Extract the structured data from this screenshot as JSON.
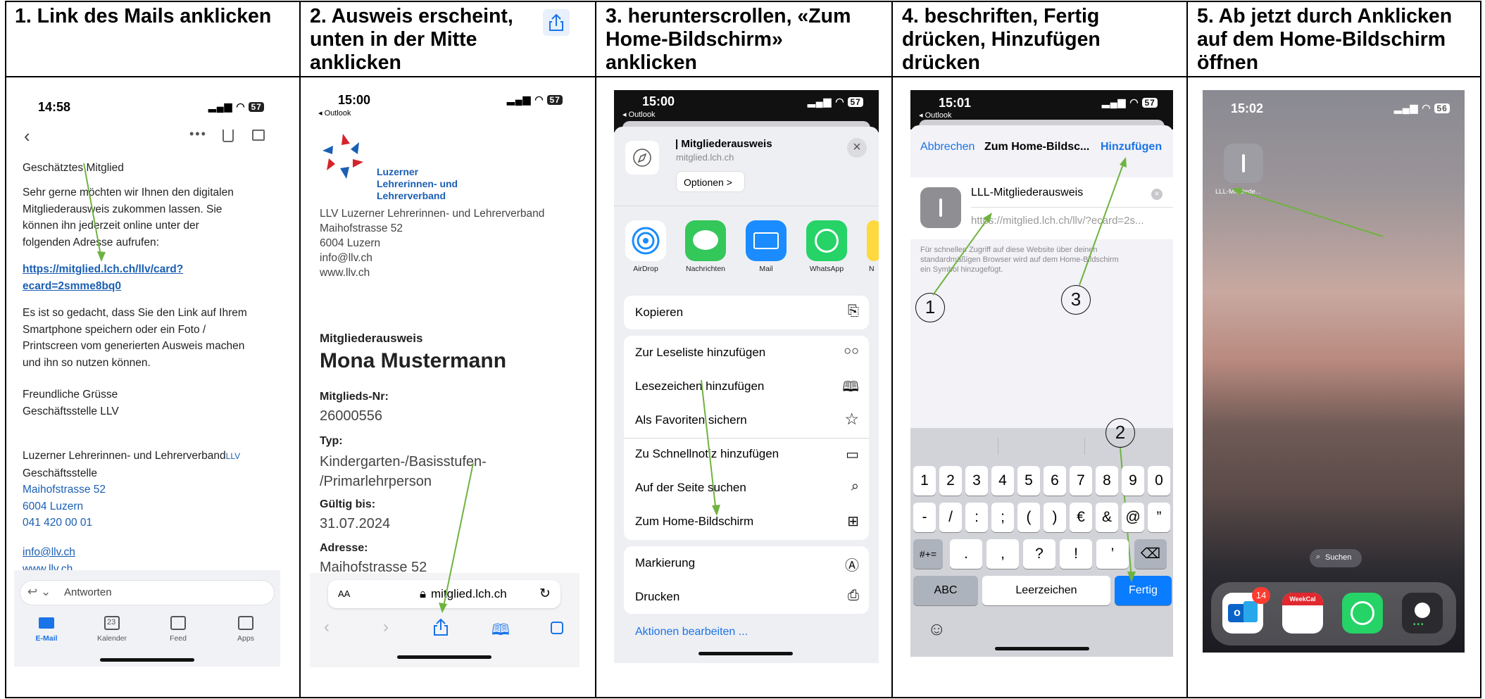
{
  "headers": [
    [
      "1. Link des Mails anklicken"
    ],
    [
      "2. Ausweis erscheint,",
      "unten in der Mitte",
      "anklicken"
    ],
    [
      "3. herunterscrollen, «Zum",
      "Home-Bildschirm»",
      "anklicken"
    ],
    [
      "4. beschriften, Fertig",
      "drücken, Hinzufügen",
      "drücken"
    ],
    [
      "5. Ab jetzt durch Anklicken",
      "auf dem Home-Bildschirm",
      "öffnen"
    ]
  ],
  "colors": {
    "accent_blue": "#0a7cff",
    "arrow_green": "#6fb33f",
    "link_blue": "#1a5fb4"
  },
  "phone1": {
    "time": "14:58",
    "battery": "57",
    "salutation": "Geschätztes Mitglied",
    "para1": [
      "Sehr gerne möchten wir Ihnen den digitalen",
      "Mitgliederausweis zukommen lassen. Sie",
      "können ihn jederzeit online unter der",
      "folgenden Adresse aufrufen:"
    ],
    "link": [
      "https://mitglied.lch.ch/llv/card?",
      "ecard=2smme8bq0"
    ],
    "para2": [
      "Es ist so gedacht, dass Sie den Link auf Ihrem",
      "Smartphone speichern oder ein Foto /",
      "Printscreen vom generierten Ausweis machen",
      "und ihn so nutzen können."
    ],
    "greeting": [
      "Freundliche Grüsse",
      "Geschäftsstelle LLV"
    ],
    "org_name": "Luzerner Lehrerinnen- und Lehrerverband",
    "org_abbr": "LLV",
    "org_office": "Geschäftsstelle",
    "street": "Maihofstrasse 52",
    "city": "6004 Luzern",
    "phone": "041 420 00 01",
    "email": "info@llv.ch",
    "web": "www.llv.ch",
    "reply": "Antworten",
    "tabs": [
      "E-Mail",
      "Kalender",
      "Feed",
      "Apps"
    ],
    "calendar_day": "23"
  },
  "phone2": {
    "time": "15:00",
    "back": "◂ Outlook",
    "battery": "57",
    "logo_text": [
      "Luzerner",
      "Lehrerinnen- und",
      "Lehrerverband"
    ],
    "address": [
      "LLV Luzerner Lehrerinnen- und Lehrerverband",
      "Maihofstrasse 52",
      "6004 Luzern",
      "info@llv.ch",
      "www.llv.ch"
    ],
    "card_label": "Mitgliederausweis",
    "member_name": "Mona Mustermann",
    "nr_label": "Mitglieds-Nr:",
    "nr_value": "26000556",
    "type_label": "Typ:",
    "type_value": [
      "Kindergarten-/Basisstufen-",
      "/Primarlehrperson"
    ],
    "valid_label": "Gültig bis:",
    "valid_value": "31.07.2024",
    "addr_label": "Adresse:",
    "addr_value": "Maihofstrasse 52",
    "aa": "AA",
    "url": "mitglied.lch.ch"
  },
  "phone3": {
    "time": "15:00",
    "back": "◂ Outlook",
    "battery": "57",
    "page_title": "| Mitgliederausweis",
    "page_url": "mitglied.lch.ch",
    "options": "Optionen >",
    "apps": [
      "AirDrop",
      "Nachrichten",
      "Mail",
      "WhatsApp",
      "N"
    ],
    "copy": "Kopieren",
    "actions1": [
      "Zur Leseliste hinzufügen",
      "Lesezeichen hinzufügen",
      "Als Favoriten sichern",
      "Zu Schnellnotiz hinzufügen",
      "Auf der Seite suchen",
      "Zum Home-Bildschirm"
    ],
    "actions2": [
      "Markierung",
      "Drucken"
    ],
    "edit_actions": "Aktionen bearbeiten ..."
  },
  "phone4": {
    "time": "15:01",
    "back": "◂ Outlook",
    "battery": "57",
    "cancel": "Abbrechen",
    "title": "Zum Home-Bildsc...",
    "add": "Hinzufügen",
    "name_value": "LLL-Mitgliederausweis",
    "url_value": "https://mitglied.lch.ch/llv/?ecard=2s...",
    "hint": [
      "Für schnellen Zugriff auf diese Website über deinen",
      "standardmäßigen Browser wird auf dem Home-Bildschirm",
      "ein Symbol hinzugefügt."
    ],
    "row1": [
      "1",
      "2",
      "3",
      "4",
      "5",
      "6",
      "7",
      "8",
      "9",
      "0"
    ],
    "row2": [
      "-",
      "/",
      ":",
      ";",
      "(",
      ")",
      "€",
      "&",
      "@",
      "”"
    ],
    "row3": [
      ".",
      ",",
      "?",
      "!",
      "’"
    ],
    "shift": "#+=",
    "abc": "ABC",
    "space": "Leerzeichen",
    "done": "Fertig",
    "markers": [
      "1",
      "2",
      "3"
    ]
  },
  "phone5": {
    "time": "15:02",
    "battery": "56",
    "shortcut_label": "LLL-Mitgliede...",
    "search": "Suchen",
    "badge": "14",
    "weekcal": "WeekCal"
  }
}
